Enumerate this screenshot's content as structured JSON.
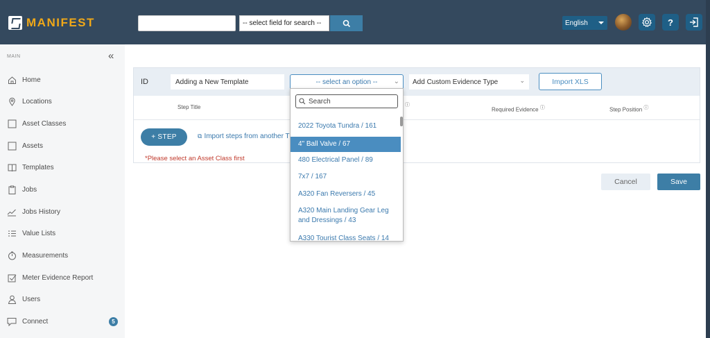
{
  "app": {
    "logo_text": "MANIFEST"
  },
  "topbar": {
    "search_value": "",
    "field_select_label": "-- select field for search --",
    "language": "English"
  },
  "sidebar": {
    "header": "MAIN",
    "items": [
      {
        "label": "Home",
        "icon": "home-icon"
      },
      {
        "label": "Locations",
        "icon": "location-pin-icon"
      },
      {
        "label": "Asset Classes",
        "icon": "square-icon"
      },
      {
        "label": "Assets",
        "icon": "square-icon"
      },
      {
        "label": "Templates",
        "icon": "book-icon"
      },
      {
        "label": "Jobs",
        "icon": "clipboard-icon"
      },
      {
        "label": "Jobs History",
        "icon": "trend-icon"
      },
      {
        "label": "Value Lists",
        "icon": "list-icon"
      },
      {
        "label": "Measurements",
        "icon": "timer-icon"
      },
      {
        "label": "Meter Evidence Report",
        "icon": "checkbox-icon"
      },
      {
        "label": "Users",
        "icon": "user-icon"
      },
      {
        "label": "Connect",
        "icon": "chat-icon",
        "badge": "5"
      }
    ]
  },
  "form": {
    "id_label": "ID",
    "template_name": "Adding a New Template",
    "asset_class_placeholder": "-- select an option --",
    "evidence_type_label": "Add Custom Evidence Type",
    "import_xls_label": "Import XLS"
  },
  "table": {
    "headers": {
      "step_title": "Step Title",
      "required_evidence": "Required Evidence",
      "step_position": "Step Position"
    },
    "add_step_label": "+ STEP",
    "import_steps_label": "Import steps from another T",
    "warning": "*Please select an Asset Class first"
  },
  "actions": {
    "cancel": "Cancel",
    "save": "Save"
  },
  "dropdown": {
    "search_placeholder": "Search",
    "options": [
      {
        "label": "2022 Toyota Tundra / 161",
        "selected": false
      },
      {
        "label": "4\" Ball Valve / 67",
        "selected": true
      },
      {
        "label": "480 Electrical Panel / 89",
        "selected": false
      },
      {
        "label": "7x7 / 167",
        "selected": false
      },
      {
        "label": "A320 Fan Reversers / 45",
        "selected": false
      },
      {
        "label": "A320 Main Landing Gear Leg and Dressings / 43",
        "selected": false
      },
      {
        "label": "A330 Tourist Class Seats / 14",
        "selected": false
      }
    ]
  },
  "colors": {
    "topbar": "#34495e",
    "accent": "#3d7ea6",
    "logo": "#f0a818",
    "warning": "#c0392b"
  }
}
